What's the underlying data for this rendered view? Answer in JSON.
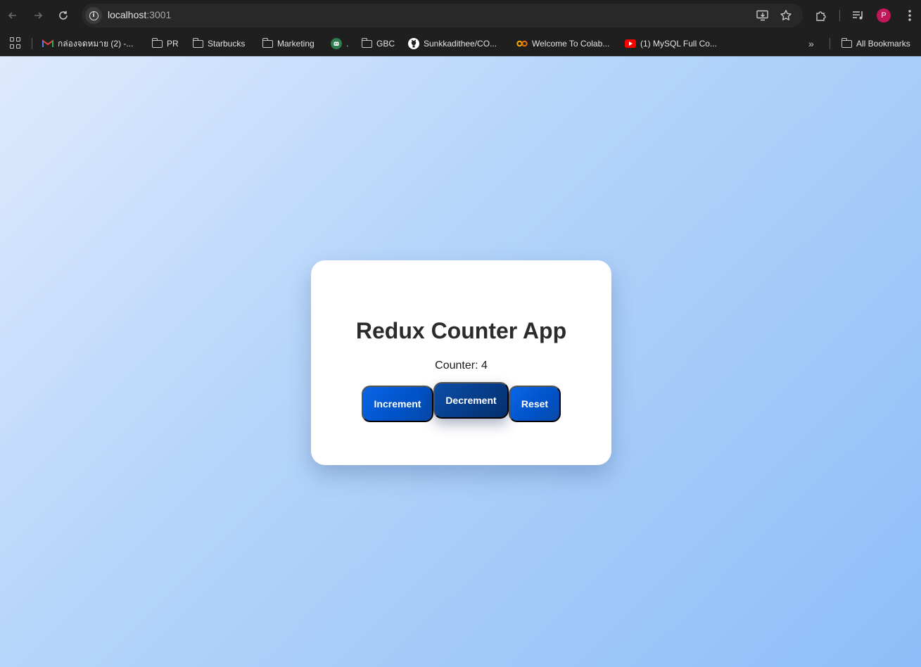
{
  "browser": {
    "url_host": "localhost",
    "url_port": ":3001",
    "profile_initial": "P",
    "icons": {
      "back": "back-arrow-icon",
      "forward": "forward-arrow-icon",
      "reload": "reload-icon",
      "site_info": "info-icon",
      "install": "install-app-icon",
      "bookmark": "star-icon",
      "extensions": "puzzle-icon",
      "media": "media-queue-icon",
      "menu": "kebab-menu-icon"
    }
  },
  "bookmarks": {
    "items": [
      {
        "label": "กล่องจดหมาย (2) -...",
        "icon": "gmail-icon"
      },
      {
        "label": "PR",
        "icon": "folder-icon"
      },
      {
        "label": "Starbucks",
        "icon": "folder-icon"
      },
      {
        "label": "Marketing",
        "icon": "folder-icon"
      },
      {
        "label": ".",
        "icon": "chatbot-icon"
      },
      {
        "label": "GBC",
        "icon": "folder-icon"
      },
      {
        "label": "Sunkkadithee/CO...",
        "icon": "github-icon"
      },
      {
        "label": "Welcome To Colab...",
        "icon": "colab-icon"
      },
      {
        "label": "(1) MySQL Full Co...",
        "icon": "youtube-icon"
      }
    ],
    "overflow": "»",
    "all_bookmarks": "All Bookmarks"
  },
  "app": {
    "title": "Redux Counter App",
    "counter_text": "Counter: 4",
    "buttons": {
      "increment": "Increment",
      "decrement": "Decrement",
      "reset": "Reset"
    }
  },
  "colors": {
    "button_primary": "#0052c6",
    "button_hover": "#063b85",
    "background_start": "#deeafd",
    "background_end": "#8dbef7"
  }
}
